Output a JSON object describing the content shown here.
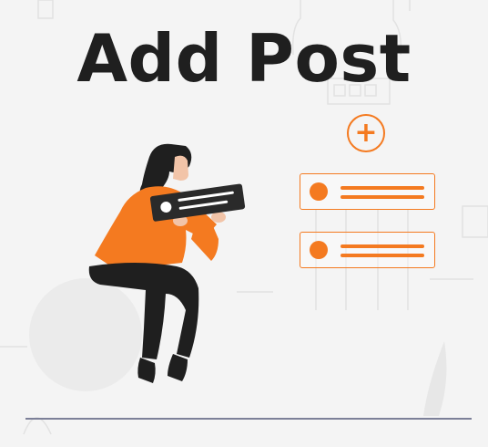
{
  "header": {
    "title": "Add Post"
  },
  "actions": {
    "add_icon_glyph": "+"
  },
  "posts": [
    {
      "id": "post-1"
    },
    {
      "id": "post-2"
    }
  ],
  "colors": {
    "accent": "#f47a20",
    "text": "#1f1f1f",
    "background": "#f4f4f4",
    "ground": "#7c8098",
    "figure_dark": "#1f1f1f"
  },
  "icons": [
    "plus-icon",
    "post-avatar-icon"
  ]
}
